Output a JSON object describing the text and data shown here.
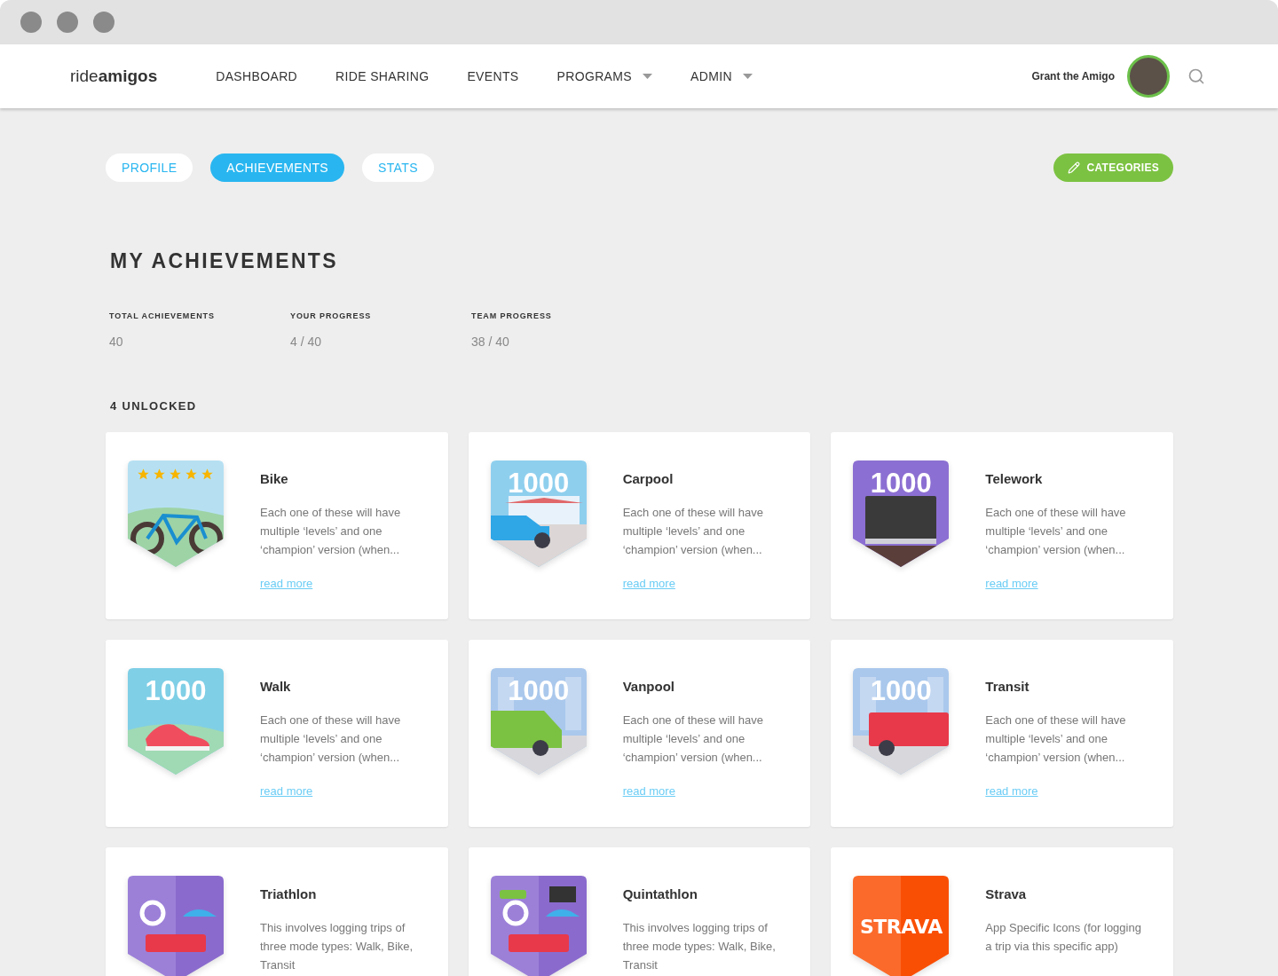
{
  "brand": {
    "light": "ride",
    "bold": "amigos"
  },
  "nav": [
    {
      "label": "DASHBOARD",
      "dropdown": false
    },
    {
      "label": "RIDE SHARING",
      "dropdown": false
    },
    {
      "label": "EVENTS",
      "dropdown": false
    },
    {
      "label": "PROGRAMS",
      "dropdown": true
    },
    {
      "label": "ADMIN",
      "dropdown": true
    }
  ],
  "user": {
    "name": "Grant the Amigo"
  },
  "tabs": [
    {
      "label": "PROFILE",
      "selected": false
    },
    {
      "label": "ACHIEVEMENTS",
      "selected": true
    },
    {
      "label": "STATS",
      "selected": false
    }
  ],
  "categories_button": "CATEGORIES",
  "heading": "MY ACHIEVEMENTS",
  "stats": [
    {
      "label": "TOTAL ACHIEVEMENTS",
      "value": "40"
    },
    {
      "label": "YOUR PROGRESS",
      "value": "4 / 40"
    },
    {
      "label": "TEAM PROGRESS",
      "value": "38 / 40"
    }
  ],
  "section_title": "4 UNLOCKED",
  "achievements": [
    {
      "title": "Bike",
      "kind": "bike",
      "stars": 5,
      "description": "Each one of these will have multiple ‘levels’ and one ‘champion’ version (when...",
      "link": "read more"
    },
    {
      "title": "Carpool",
      "kind": "carpool",
      "badge_text": "1000",
      "description": "Each one of these will have multiple ‘levels’ and one ‘champion’ version (when...",
      "link": "read more"
    },
    {
      "title": "Telework",
      "kind": "telework",
      "badge_text": "1000",
      "description": "Each one of these will have multiple ‘levels’ and one ‘champion’ version (when...",
      "link": "read more"
    },
    {
      "title": "Walk",
      "kind": "walk",
      "badge_text": "1000",
      "description": "Each one of these will have multiple ‘levels’ and one ‘champion’ version (when...",
      "link": "read more"
    },
    {
      "title": "Vanpool",
      "kind": "vanpool",
      "badge_text": "1000",
      "description": "Each one of these will have multiple ‘levels’ and one ‘champion’ version (when...",
      "link": "read more"
    },
    {
      "title": "Transit",
      "kind": "transit",
      "badge_text": "1000",
      "description": "Each one of these will have multiple ‘levels’ and one ‘champion’ version (when...",
      "link": "read more"
    },
    {
      "title": "Triathlon",
      "kind": "triathlon",
      "description": "This involves logging trips of three mode types: Walk, Bike, Transit"
    },
    {
      "title": "Quintathlon",
      "kind": "quintathlon",
      "description": "This involves logging trips of three mode types: Walk, Bike, Transit"
    },
    {
      "title": "Strava",
      "kind": "strava",
      "badge_text": "STRAVA",
      "description": "App Specific Icons (for logging a trip via this specific app)"
    }
  ]
}
